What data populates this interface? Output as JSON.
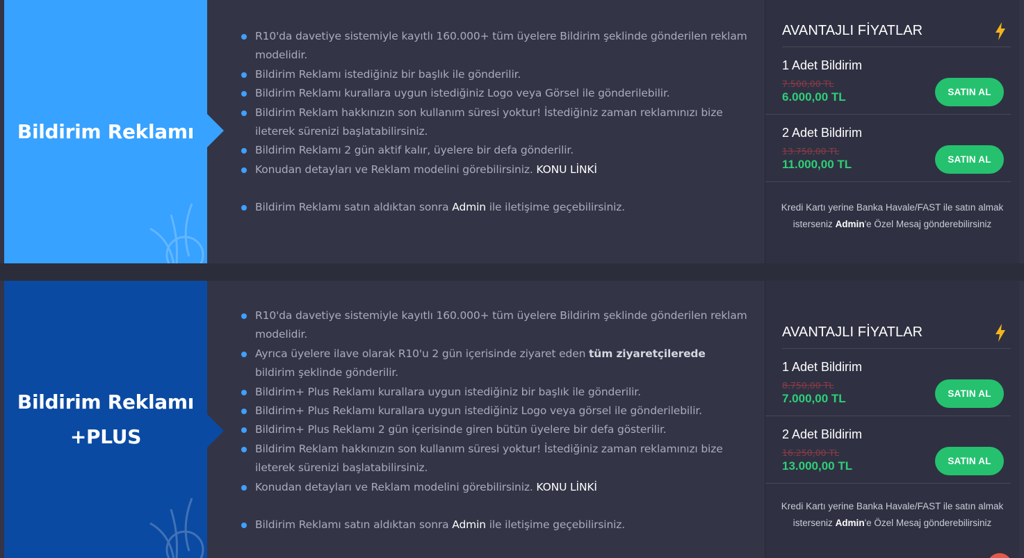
{
  "colors": {
    "accent_blue": "#37a2ff",
    "accent_navy": "#0b4aa2",
    "price_green": "#2ecf78",
    "button_green": "#25c16f",
    "old_price_red": "#8a3c46"
  },
  "products": [
    {
      "title": "Bildirim Reklamı",
      "features": {
        "f0": "R10'da davetiye sistemiyle kayıtlı 160.000+ tüm üyelere Bildirim şeklinde gönderilen reklam modelidir.",
        "f1": "Bildirim Reklamı istediğiniz bir başlık ile gönderilir.",
        "f2": "Bildirim Reklamı kurallara uygun istediğiniz Logo veya Görsel ile gönderilebilir.",
        "f3": "Bildirim Reklam hakkınızın son kullanım süresi yoktur! İstediğiniz zaman reklamınızı bize ileterek sürenizi başlatabilirsiniz.",
        "f4": "Bildirim Reklamı 2 gün aktif kalır, üyelere bir defa gönderilir.",
        "f5_text": "Konudan detayları ve Reklam modelini görebilirsiniz.",
        "f5_link": "KONU LİNKİ",
        "f6_pre": "Bildirim Reklamı satın aldıktan sonra",
        "f6_admin": "Admin",
        "f6_post": "ile iletişime geçebilirsiniz."
      },
      "pricing": {
        "heading": "AVANTAJLI FİYATLAR",
        "tiers": [
          {
            "name": "1 Adet Bildirim",
            "old_price": "7.500,00 TL",
            "new_price": "6.000,00 TL",
            "button": "SATIN AL"
          },
          {
            "name": "2 Adet Bildirim",
            "old_price": "13.750,00 TL",
            "new_price": "11.000,00 TL",
            "button": "SATIN AL"
          }
        ],
        "note_pre": "Kredi Kartı yerine Banka Havale/FAST ile satın almak isterseniz",
        "note_admin": "Admin",
        "note_post": "'e Özel Mesaj gönderebilirsiniz"
      }
    },
    {
      "title": "Bildirim Reklamı\n+PLUS",
      "features": {
        "f0": "R10'da davetiye sistemiyle kayıtlı 160.000+ tüm üyelere Bildirim şeklinde gönderilen reklam modelidir.",
        "f1_pre": "Ayrıca üyelere ilave olarak R10'u 2 gün içerisinde ziyaret eden",
        "f1_bold": "tüm ziyaretçilerede",
        "f1_post": "bildirim şeklinde gönderilir.",
        "f2": "Bildirim+ Plus Reklamı kurallara uygun istediğiniz bir başlık ile gönderilir.",
        "f3": "Bildirim+ Plus Reklamı kurallara uygun istediğiniz Logo veya görsel ile gönderilebilir.",
        "f4": "Bildirim+ Plus Reklamı 2 gün içerisinde giren bütün üyelere bir defa gösterilir.",
        "f5": "Bildirim Reklam hakkınızın son kullanım süresi yoktur! İstediğiniz zaman reklamınızı bize ileterek sürenizi başlatabilirsiniz.",
        "f6_text": "Konudan detayları ve Reklam modelini görebilirsiniz.",
        "f6_link": "KONU LİNKİ",
        "f7_pre": "Bildirim Reklamı satın aldıktan sonra",
        "f7_admin": "Admin",
        "f7_post": "ile iletişime geçebilirsiniz."
      },
      "pricing": {
        "heading": "AVANTAJLI FİYATLAR",
        "tiers": [
          {
            "name": "1 Adet Bildirim",
            "old_price": "8.750,00 TL",
            "new_price": "7.000,00 TL",
            "button": "SATIN AL"
          },
          {
            "name": "2 Adet Bildirim",
            "old_price": "16.250,00 TL",
            "new_price": "13.000,00 TL",
            "button": "SATIN AL"
          }
        ],
        "note_pre": "Kredi Kartı yerine Banka Havale/FAST ile satın almak isterseniz",
        "note_admin": "Admin",
        "note_post": "'e Özel Mesaj gönderebilirsiniz"
      }
    }
  ]
}
